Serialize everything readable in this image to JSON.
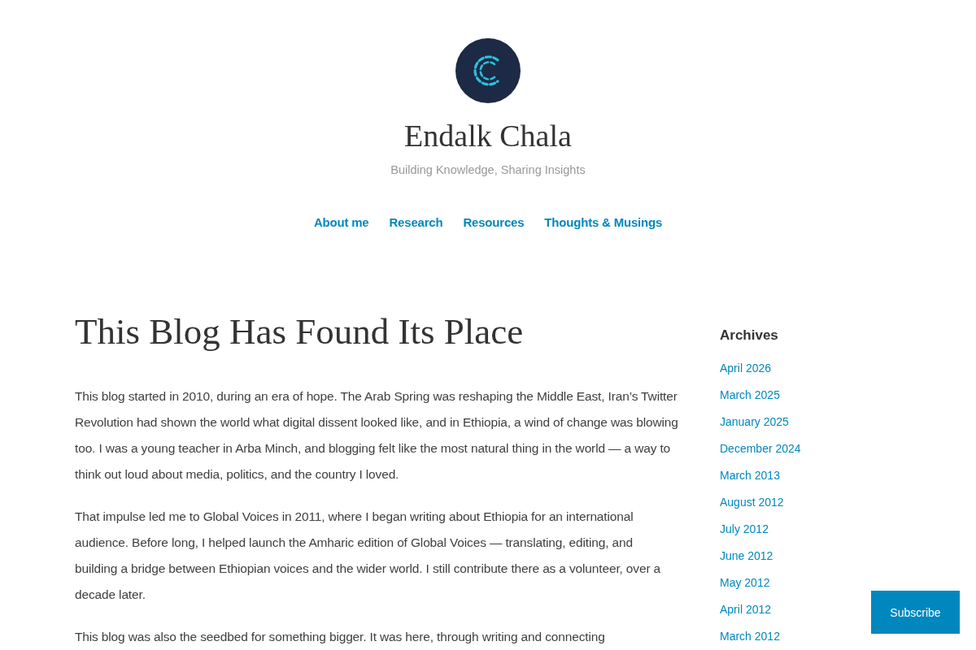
{
  "site": {
    "title": "Endalk Chala",
    "tagline": "Building Knowledge, Sharing Insights"
  },
  "nav": [
    {
      "label": "About me"
    },
    {
      "label": "Research"
    },
    {
      "label": "Resources"
    },
    {
      "label": "Thoughts & Musings"
    }
  ],
  "post": {
    "title": "This Blog Has Found Its Place",
    "paragraphs": [
      "This blog started in 2010, during an era of hope. The Arab Spring was reshaping the Middle East, Iran’s Twitter Revolution had shown the world what digital dissent looked like, and in Ethiopia, a wind of change was blowing too. I was a young teacher in Arba Minch, and blogging felt like the most natural thing in the world — a way to think out loud about media, politics, and the country I loved.",
      "That impulse led me to Global Voices in 2011, where I began writing about Ethiopia for an international audience. Before long, I helped launch the Amharic edition of Global Voices — translating, editing, and building a bridge between Ethiopian voices and the wider world. I still contribute there as a volunteer, over a decade later.",
      "This blog was also the seedbed for something bigger. It was here, through writing and connecting"
    ]
  },
  "sidebar": {
    "heading": "Archives",
    "items": [
      "April 2026",
      "March 2025",
      "January 2025",
      "December 2024",
      "March 2013",
      "August 2012",
      "July 2012",
      "June 2012",
      "May 2012",
      "April 2012",
      "March 2012"
    ]
  },
  "subscribe_button": "Subscribe"
}
